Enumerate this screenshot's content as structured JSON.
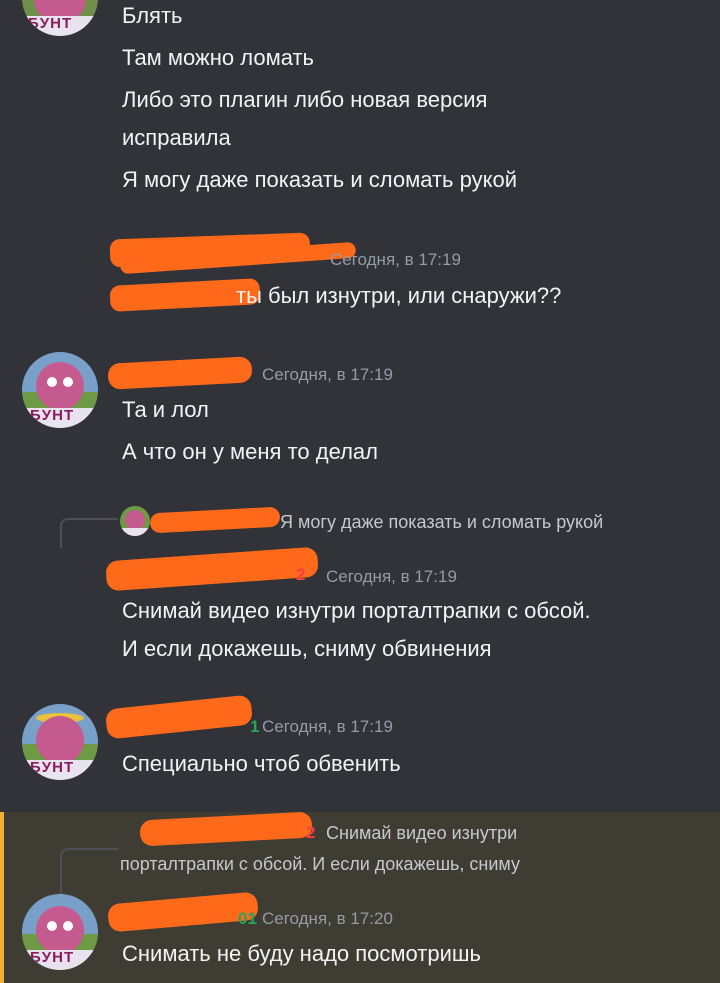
{
  "colors": {
    "background": "#313338",
    "text": "#f2f3f5",
    "timestamp": "#949ba4",
    "redaction": "#ff6a1a",
    "highlight": "#3f3d33",
    "highlight_bar": "#f0b232",
    "badge_red": "#f23f43",
    "badge_green": "#23a55a"
  },
  "avatar_text": "ƂУНТ",
  "group1": {
    "lines": [
      "Блять",
      "Там можно ломать",
      "Либо это плагин либо новая версия",
      "исправила",
      "Я могу даже показать и сломать рукой"
    ]
  },
  "group2": {
    "timestamp": "Сегодня, в 17:19",
    "lines": [
      "ты был изнутри, или снаружи??"
    ]
  },
  "group3": {
    "timestamp": "Сегодня, в 17:19",
    "lines": [
      "Та и лол",
      "А что он у меня то делал"
    ]
  },
  "group4": {
    "reply_snippet": "Я могу даже показать и сломать рукой",
    "badge": "2",
    "timestamp": "Сегодня, в 17:19",
    "lines": [
      "Снимай видео изнутри порталтрапки с обсой.",
      "И если докажешь, сниму обвинения"
    ]
  },
  "group5": {
    "badge": "1",
    "timestamp": "Сегодня, в 17:19",
    "lines": [
      "Специально чтоб обвенить"
    ]
  },
  "group6": {
    "reply_badge": "2",
    "reply_snippet_1": "Снимай видео изнутри",
    "reply_snippet_2": "порталтрапки с обсой. И если докажешь, сниму",
    "badge": "01",
    "timestamp": "Сегодня, в 17:20",
    "lines": [
      "Снимать не буду надо посмотришь"
    ]
  }
}
